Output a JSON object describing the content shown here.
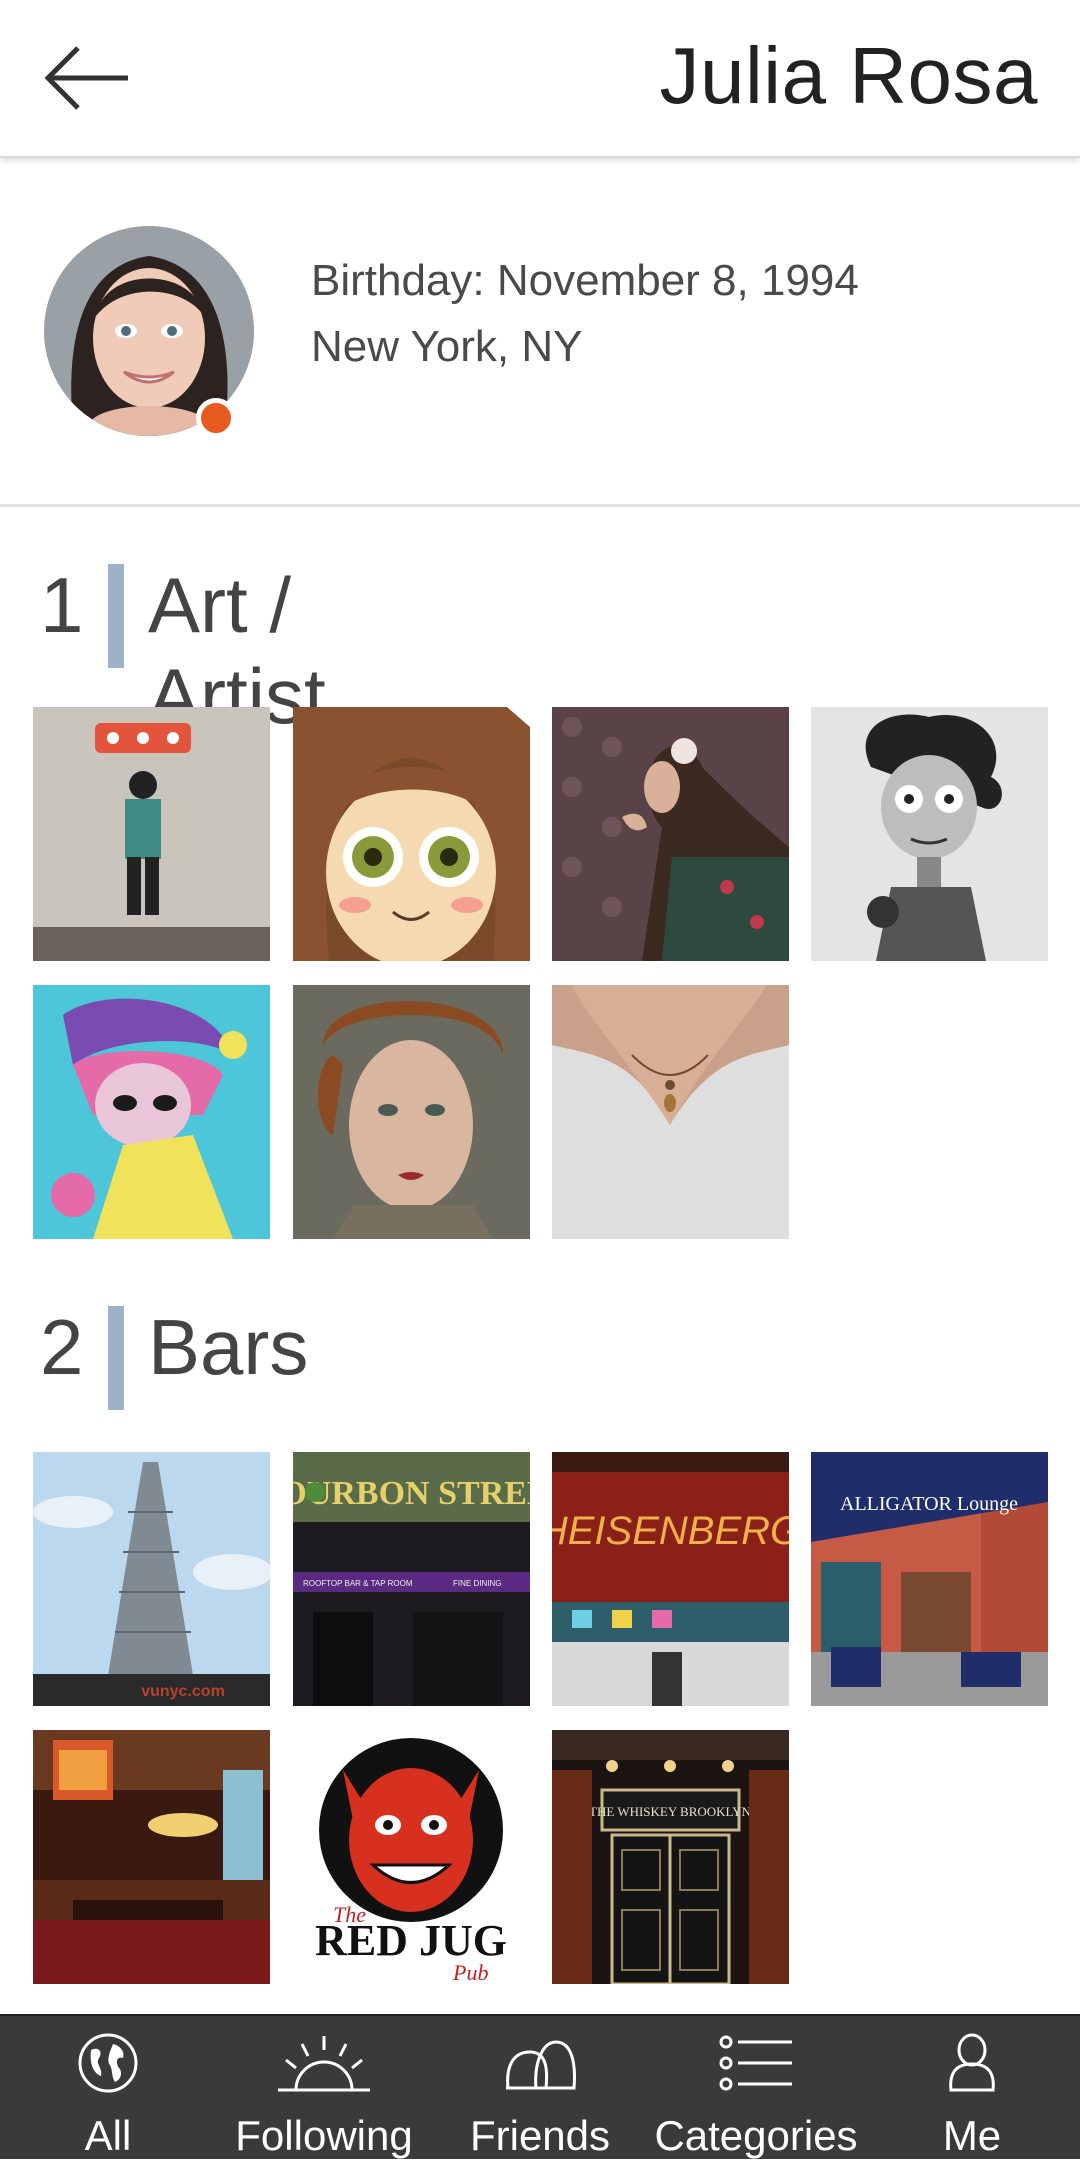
{
  "header": {
    "title": "Julia Rosa",
    "back_icon": "arrow-left-icon"
  },
  "profile": {
    "birthday": "Birthday: November 8, 1994",
    "location": "New York, NY",
    "status_color": "#e85a1e"
  },
  "sections": [
    {
      "number": "1",
      "name": "Art / Artist",
      "items": [
        "street-art-kid",
        "cartoon-girl",
        "woman-portrait-wall",
        "tim-burton-figure",
        "colorful-girl-drawing",
        "painted-woman-face",
        "necklace-photo"
      ]
    },
    {
      "number": "2",
      "name": "Bars",
      "items": [
        "empire-state-building",
        "bourbon-street",
        "heisenberg",
        "alligator-lounge",
        "bar-interior",
        "the-red-jug-pub",
        "the-whiskey-brooklyn"
      ]
    }
  ],
  "bar_signs": {
    "vunyc": "vunyc.com",
    "bourbon": "BOURBON STREET",
    "bourbon_sub_left": "ROOFTOP BAR & TAP ROOM",
    "bourbon_sub_right": "FINE DINING",
    "heisenberg": "HEISENBERG",
    "alligator": "ALLIGATOR Lounge",
    "redjug_the": "The",
    "redjug_main": "RED JUG",
    "redjug_pub": "Pub",
    "whiskey": "THE WHISKEY BROOKLYN"
  },
  "nav": [
    {
      "label": "All",
      "icon": "globe-icon"
    },
    {
      "label": "Following",
      "icon": "sun-icon"
    },
    {
      "label": "Friends",
      "icon": "friends-icon"
    },
    {
      "label": "Categories",
      "icon": "list-icon"
    },
    {
      "label": "Me",
      "icon": "person-icon"
    }
  ],
  "colors": {
    "section_bar": "#9db2c7",
    "nav_bg": "#3a3a3a"
  }
}
